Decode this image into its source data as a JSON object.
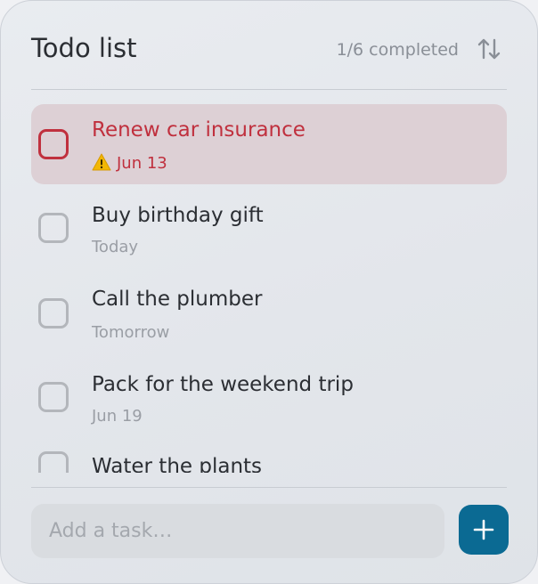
{
  "header": {
    "title": "Todo list",
    "status": "1/6 completed",
    "sort_icon": "sort-arrows-icon"
  },
  "tasks": [
    {
      "title": "Renew car insurance",
      "due": "Jun 13",
      "overdue": true,
      "completed": false,
      "icon": "warning-icon"
    },
    {
      "title": "Buy birthday gift",
      "due": "Today",
      "overdue": false,
      "completed": false
    },
    {
      "title": "Call the plumber",
      "due": "Tomorrow",
      "overdue": false,
      "completed": false
    },
    {
      "title": "Pack for the weekend trip",
      "due": "Jun 19",
      "overdue": false,
      "completed": false
    },
    {
      "title": "Water the plants",
      "overdue": false,
      "completed": false
    }
  ],
  "composer": {
    "placeholder": "Add a task…",
    "add_icon": "plus-icon"
  },
  "colors": {
    "accent": "#0b6a93",
    "overdue": "#c0303e",
    "overdue_bg": "#ddd0d5",
    "warning": "#f2b705"
  }
}
